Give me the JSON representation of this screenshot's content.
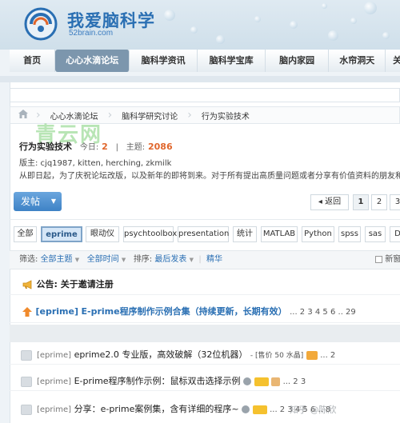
{
  "site": {
    "title": "我爱脑科学",
    "domain": "52brain.com"
  },
  "nav": {
    "items": [
      "首页",
      "心心水滴论坛",
      "脑科学资讯",
      "脑科学宝库",
      "脑内家园",
      "水帘洞天",
      "关"
    ]
  },
  "breadcrumb": [
    "心心水滴论坛",
    "脑科学研究讨论",
    "行为实验技术"
  ],
  "watermark": "青云网",
  "forum": {
    "title": "行为实验技术",
    "today_label": "今日:",
    "today": "2",
    "sep": "|",
    "topics_label": "主题:",
    "topics": "2086",
    "moderators": "版主: cjq1987, kitten, herching, zkmilk",
    "description": "从即日起，为了庆祝论坛改版，以及新年的即将到来。对于所有提出高质量问题或者分享有价值资料的朋友和同学，"
  },
  "post_button": {
    "label": "发帖",
    "arrow": "▼"
  },
  "pager": {
    "back": "◂ 返回",
    "pages": [
      "1",
      "2",
      "3"
    ],
    "current": "1"
  },
  "types": [
    "全部",
    "eprime",
    "眼动仪",
    "psychtoolbox",
    "presentation",
    "统计",
    "MATLAB",
    "Python",
    "spss",
    "sas",
    "D"
  ],
  "active_type": "eprime",
  "filter": {
    "label": "筛选:",
    "all_topics": "全部主题",
    "all_time": "全部时间",
    "sort_label": "排序:",
    "sort_value": "最后发表",
    "featured": "精华",
    "new_window": "新窗"
  },
  "announcement": {
    "label": "公告: 关于邀请注册"
  },
  "threads": [
    {
      "tag": "[eprime]",
      "title": "E-prime程序制作示例合集（持续更新，长期有效）",
      "extra": "",
      "pages": "... 2 3 4 5 6 .. 29"
    },
    {
      "tag": "[eprime]",
      "title": "eprime2.0 专业版，高效破解（32位机器）",
      "extra": "- [售价 50 水晶]",
      "pages": "... 2"
    },
    {
      "tag": "[eprime]",
      "title": "E-prime程序制作示例：鼠标双击选择示例",
      "extra": "",
      "pages": "... 2 3"
    },
    {
      "tag": "[eprime]",
      "title": "分享：e-prime案例集，含有详细的程序~",
      "extra": "",
      "pages": "... 2 3 4 5 6 .. 8"
    }
  ],
  "corner_watermark": "知乎 @陈欣",
  "colors": {
    "brand_blue": "#2a6fb3",
    "accent_orange": "#e0662c",
    "nav_active": "#7c96ad",
    "post_button": "#3e82c6"
  }
}
